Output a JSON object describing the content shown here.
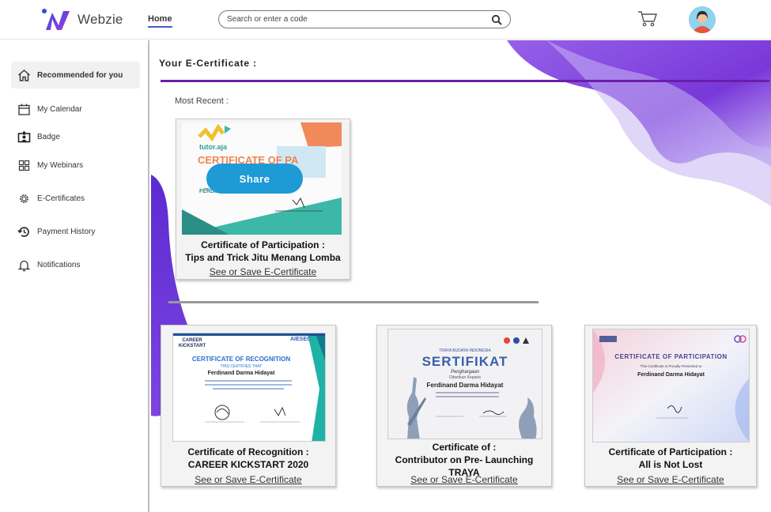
{
  "header": {
    "brand": "Webzie",
    "nav_home": "Home",
    "search_placeholder": "Search or enter a code"
  },
  "sidebar": {
    "items": [
      {
        "label": "Recommended for you",
        "icon": "home-icon"
      },
      {
        "label": "My Calendar",
        "icon": "calendar-icon"
      },
      {
        "label": "Badge",
        "icon": "badge-icon"
      },
      {
        "label": "My Webinars",
        "icon": "grid-icon"
      },
      {
        "label": "E-Certificates",
        "icon": "gear-icon"
      },
      {
        "label": "Payment History",
        "icon": "history-icon"
      },
      {
        "label": "Notifications",
        "icon": "bell-icon"
      }
    ]
  },
  "main": {
    "title": "Your E-Certificate :",
    "most_recent_label": "Most Recent :",
    "featured": {
      "title_line1": "Certificate of Participation :",
      "title_line2": "Tips and Trick Jitu Menang Lomba",
      "link": "See or Save E-Certificate",
      "share_label": "Share",
      "img": {
        "brand": "tutor.aja",
        "heading": "CERTIFICATE OF PA",
        "name": "FERDINAND DARMA"
      }
    },
    "certificates": [
      {
        "title_line1": "Certificate of Recognition :",
        "title_line2": "CAREER KICKSTART 2020",
        "title_line3": "",
        "link": "See or Save E-Certificate",
        "img": {
          "brand": "CAREER KICKSTART",
          "heading": "CERTIFICATE OF RECOGNITION",
          "sub": "THIS CERTIFIES THAT",
          "name": "Ferdinand Darma Hidayat",
          "partner": "AIESEC"
        }
      },
      {
        "title_line1": "Certificate of :",
        "title_line2": "Contributor on Pre- Launching",
        "title_line3": "TRAYA",
        "link": "See or Save E-Certificate",
        "img": {
          "org": "TRAYA BUDAYA INDONESIA",
          "heading": "SERTIFIKAT",
          "sub": "Penghargaan",
          "sub2": "Diberikan Kepada",
          "name": "Ferdinand Darma Hidayat"
        }
      },
      {
        "title_line1": "Certificate of Participation :",
        "title_line2": "All is Not Lost",
        "title_line3": "",
        "link": "See or Save E-Certificate",
        "img": {
          "heading": "CERTIFICATE OF PARTICIPATION",
          "sub": "This Certificate is Proudly Presented to",
          "name": "Ferdinand Darma Hidayat"
        }
      }
    ]
  },
  "colors": {
    "accent": "#6a1ea8",
    "share": "#1e9ad6",
    "blob": "#7b3fe4",
    "nav_underline": "#3f5fd0"
  }
}
